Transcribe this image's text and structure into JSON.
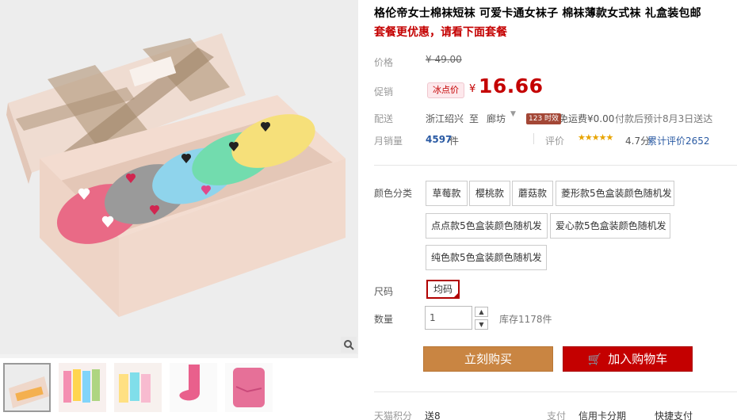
{
  "product": {
    "title": "格伦帝女士棉袜短袜 可爱卡通女袜子 棉袜薄款女式袜 礼盒装包邮",
    "subtitle": "套餐更优惠，请看下面套餐"
  },
  "price": {
    "label": "价格",
    "original": "¥ 49.00",
    "promo_label": "促销",
    "promo_badge": "冰点价",
    "currency": "¥",
    "promo_value": "16.66"
  },
  "shipping": {
    "label": "配送",
    "from": "浙江绍兴",
    "to_word": "至",
    "destination": "廊坊",
    "tag": "123 时效",
    "fee": "免运费¥0.00",
    "eta": "付款后预计8月3日送达"
  },
  "stats": {
    "sales_label": "月销量",
    "sales_count": "4597",
    "sales_unit": "件",
    "rating_label": "评价",
    "stars": "★★★★★",
    "score": "4.7分",
    "reviews": "累计评价2652"
  },
  "options": {
    "color_label": "颜色分类",
    "colors": [
      "草莓款",
      "樱桃款",
      "蘑菇款",
      "菱形款5色盒装颜色随机发",
      "点点款5色盒装颜色随机发",
      "爱心款5色盒装颜色随机发",
      "纯色款5色盒装颜色随机发"
    ],
    "size_label": "尺码",
    "size": "均码",
    "qty_label": "数量",
    "qty_value": "1",
    "qty_up": "▲",
    "qty_down": "▼",
    "stock": "库存1178件"
  },
  "actions": {
    "buy_now": "立刻购买",
    "add_to_cart": "加入购物车",
    "cart_icon": "🛒"
  },
  "footer": {
    "points_label": "天猫积分",
    "points_value": "送8",
    "pay_label": "支付",
    "pay_method1": "信用卡分期",
    "pay_method2": "快捷支付"
  },
  "colors": {
    "accent_red": "#c40000",
    "buy_orange": "#c98542",
    "link_blue": "#2a5aa3"
  }
}
